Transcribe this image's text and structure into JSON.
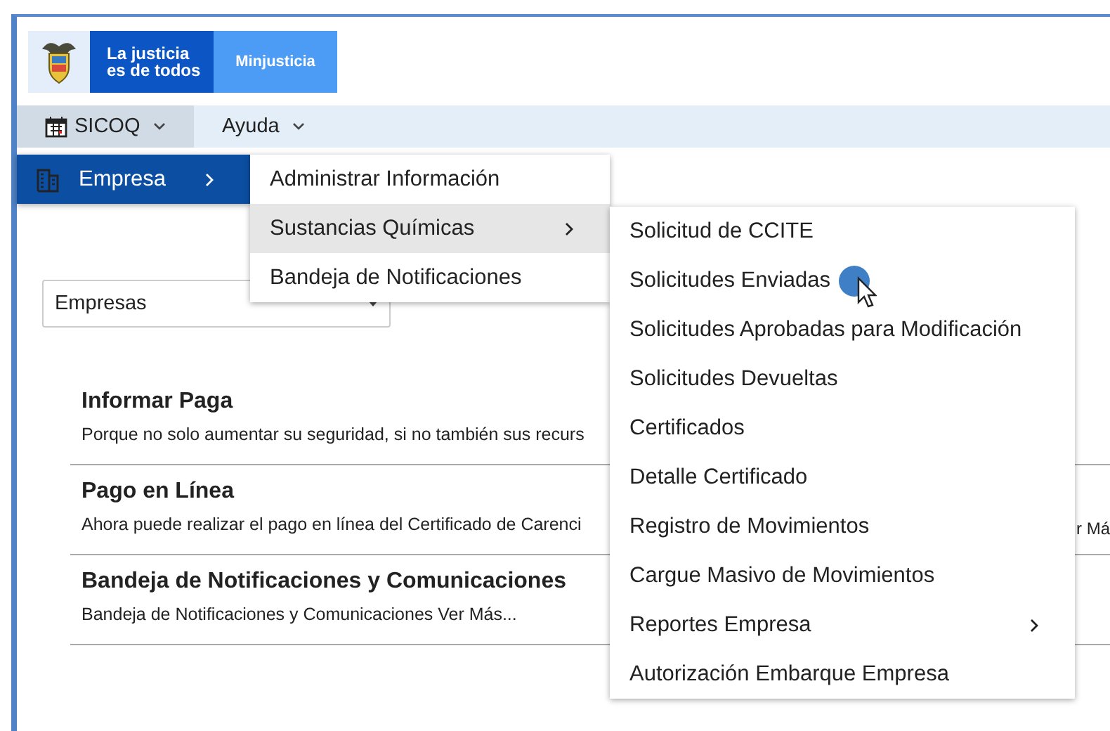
{
  "header": {
    "slogan": "La justicia\nes de todos",
    "brand": "Minjusticia"
  },
  "nav": [
    {
      "label": "SICOQ",
      "selected": true,
      "kind": "calendar"
    },
    {
      "label": "Ayuda",
      "selected": false,
      "kind": "plain"
    }
  ],
  "menu": {
    "items": [
      {
        "label": "Empresa",
        "selected": true,
        "has_submenu": true
      }
    ]
  },
  "submenu": {
    "items": [
      {
        "label": "Administrar Información",
        "selected": false,
        "has_submenu": false
      },
      {
        "label": "Sustancias Químicas",
        "selected": true,
        "has_submenu": true
      },
      {
        "label": "Bandeja de Notificaciones",
        "selected": false,
        "has_submenu": false
      }
    ]
  },
  "subsubmenu": {
    "items": [
      {
        "label": "Solicitud de CCITE",
        "selected": false,
        "has_submenu": false
      },
      {
        "label": "Solicitudes Enviadas",
        "selected": false,
        "has_submenu": false
      },
      {
        "label": "Solicitudes Aprobadas para Modificación",
        "selected": false,
        "has_submenu": false
      },
      {
        "label": "Solicitudes Devueltas",
        "selected": false,
        "has_submenu": false
      },
      {
        "label": "Certificados",
        "selected": false,
        "has_submenu": false
      },
      {
        "label": "Detalle Certificado",
        "selected": false,
        "has_submenu": false
      },
      {
        "label": "Registro de Movimientos",
        "selected": false,
        "has_submenu": false
      },
      {
        "label": "Cargue Masivo de Movimientos",
        "selected": false,
        "has_submenu": false
      },
      {
        "label": "Reportes Empresa",
        "selected": false,
        "has_submenu": true
      },
      {
        "label": "Autorización Embarque Empresa",
        "selected": false,
        "has_submenu": false
      }
    ]
  },
  "select": {
    "value": "Empresas"
  },
  "cards": [
    {
      "title": "Informar Paga",
      "description": "Porque no solo aumentar su seguridad, si no también sus recurs"
    },
    {
      "title": "Pago en Línea",
      "description": "Ahora puede realizar el pago en línea del Certificado de Carenci",
      "trailing_text": "r Má"
    },
    {
      "title": "Bandeja de Notificaciones y Comunicaciones",
      "description": "Bandeja de Notificaciones y Comunicaciones Ver Más..."
    }
  ]
}
